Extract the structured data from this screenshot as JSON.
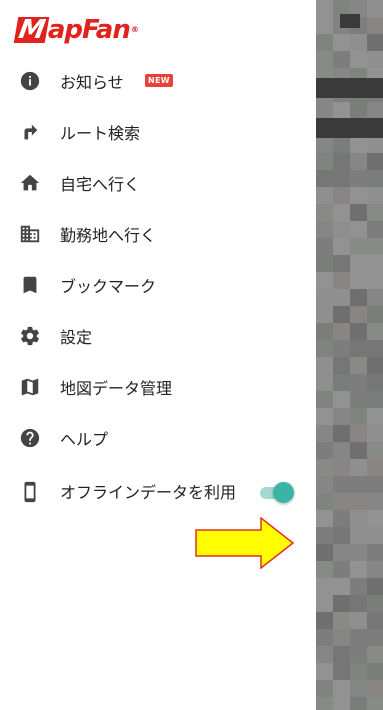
{
  "app": {
    "logo_text": "MapFan"
  },
  "menu": {
    "items": [
      {
        "label": "お知らせ",
        "icon": "info-icon",
        "badge": "NEW"
      },
      {
        "label": "ルート検索",
        "icon": "route-turn-icon"
      },
      {
        "label": "自宅へ行く",
        "icon": "home-icon"
      },
      {
        "label": "勤務地へ行く",
        "icon": "office-building-icon"
      },
      {
        "label": "ブックマーク",
        "icon": "bookmark-icon"
      },
      {
        "label": "設定",
        "icon": "gear-icon"
      },
      {
        "label": "地図データ管理",
        "icon": "map-icon"
      },
      {
        "label": "ヘルプ",
        "icon": "help-icon"
      },
      {
        "label": "オフラインデータを利用",
        "icon": "phone-icon",
        "toggle_on": true
      }
    ]
  },
  "colors": {
    "brand_red": "#e0231c",
    "badge_red": "#e8433a",
    "toggle_accent": "#3cb4a4",
    "annotation_arrow_fill": "#ffff00",
    "annotation_arrow_stroke": "#e03020"
  }
}
